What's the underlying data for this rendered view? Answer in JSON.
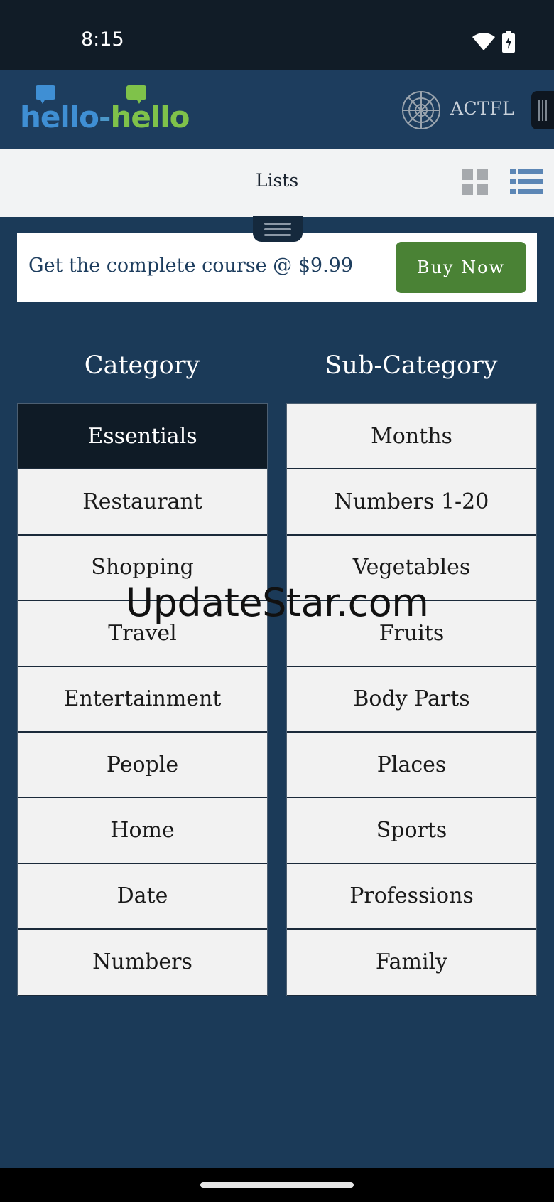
{
  "status_bar": {
    "time": "8:15",
    "wifi_icon": "wifi-icon",
    "battery_icon": "battery-charging-icon"
  },
  "header": {
    "logo": {
      "part_a": "hello",
      "dash": "-",
      "part_b": "hello",
      "colors": {
        "blue": "#3f8fd4",
        "green": "#7fc24a"
      }
    },
    "partner_logo_icon": "actfl-emblem-icon",
    "partner_label": "ACTFL"
  },
  "toolbar": {
    "title": "Lists",
    "view_icons": [
      "grid-view-icon",
      "list-view-icon"
    ],
    "active_view": "list"
  },
  "promo": {
    "text": "Get the complete course @ $9.99",
    "button_label": "Buy Now",
    "button_color": "#4a8235"
  },
  "columns": {
    "category_heading": "Category",
    "subcategory_heading": "Sub-Category"
  },
  "categories": [
    {
      "label": "Essentials",
      "selected": true
    },
    {
      "label": "Restaurant"
    },
    {
      "label": "Shopping"
    },
    {
      "label": "Travel"
    },
    {
      "label": "Entertainment"
    },
    {
      "label": "People"
    },
    {
      "label": "Home"
    },
    {
      "label": "Date"
    },
    {
      "label": "Numbers"
    }
  ],
  "subcategories": [
    {
      "label": "Months"
    },
    {
      "label": "Numbers 1-20"
    },
    {
      "label": "Vegetables"
    },
    {
      "label": "Fruits"
    },
    {
      "label": "Body Parts"
    },
    {
      "label": "Places"
    },
    {
      "label": "Sports"
    },
    {
      "label": "Professions"
    },
    {
      "label": "Family"
    }
  ],
  "watermark": "UpdateStar.com",
  "colors": {
    "background": "#1b3a58",
    "status_bar": "#111c27",
    "selected_item": "#0f1b26"
  }
}
